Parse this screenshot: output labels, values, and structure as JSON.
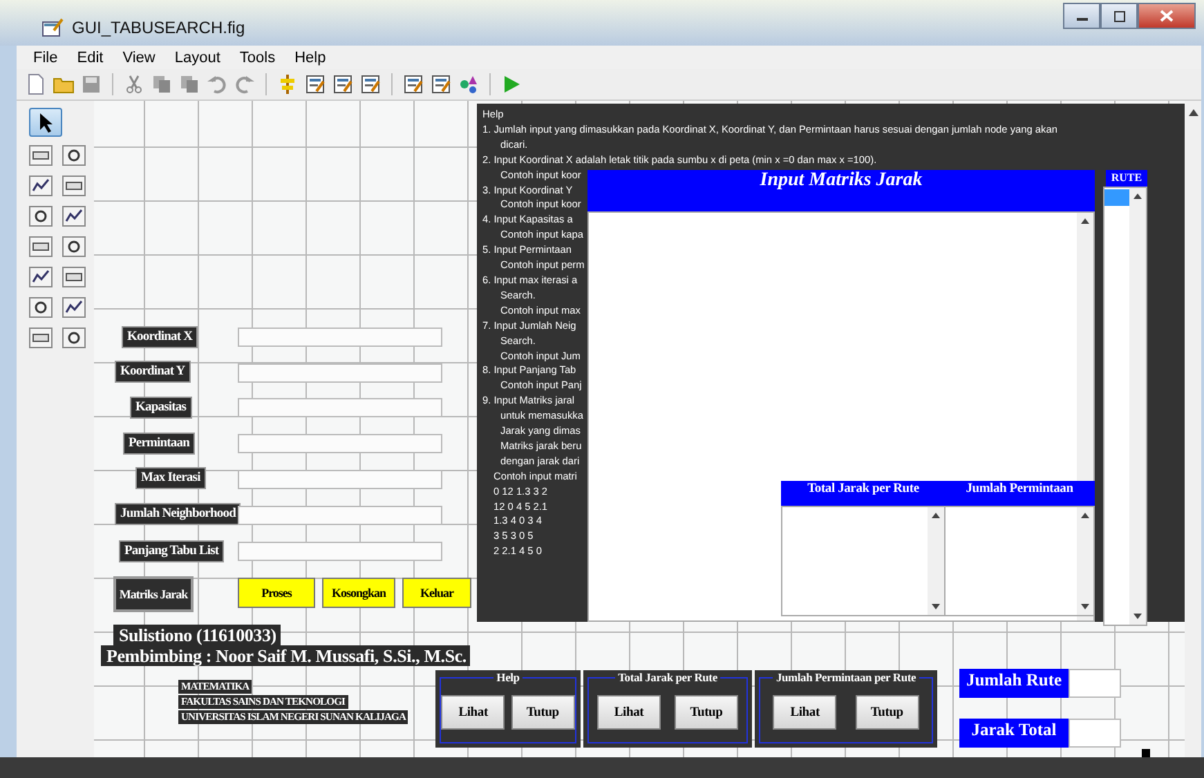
{
  "window": {
    "title": "GUI_TABUSEARCH.fig"
  },
  "menu": [
    "File",
    "Edit",
    "View",
    "Layout",
    "Tools",
    "Help"
  ],
  "fields": [
    {
      "label": "Koordinat X"
    },
    {
      "label": "Koordinat Y"
    },
    {
      "label": "Kapasitas"
    },
    {
      "label": "Permintaan"
    },
    {
      "label": "Max Iterasi"
    },
    {
      "label": "Jumlah Neighborhood"
    },
    {
      "label": "Panjang Tabu List"
    }
  ],
  "buttons": [
    {
      "label": "Matriks Jarak",
      "kind": "dark"
    },
    {
      "label": "Proses",
      "kind": "yellow"
    },
    {
      "label": "Kosongkan",
      "kind": "yellow"
    },
    {
      "label": "Keluar",
      "kind": "yellow"
    }
  ],
  "author": {
    "name": "Sulistiono (11610033)",
    "supervisor": "Pembimbing : Noor Saif M. Mussafi, S.Si., M.Sc."
  },
  "institution": [
    "MATEMATIKA",
    "FAKULTAS SAINS DAN TEKNOLOGI",
    "UNIVERSITAS ISLAM NEGERI SUNAN KALIJAGA"
  ],
  "help_panel": {
    "lines": [
      {
        "kind": "plain",
        "text": "Help"
      },
      {
        "kind": "item",
        "text": "1. Jumlah input yang dimasukkan pada Koordinat X, Koordinat Y, dan Permintaan harus sesuai dengan jumlah node yang akan"
      },
      {
        "kind": "cont",
        "text": "dicari."
      },
      {
        "kind": "item",
        "text": "2. Input Koordinat X adalah letak titik pada sumbu x di peta (min x =0 dan max x =100)."
      },
      {
        "kind": "cont",
        "text": "Contoh input koor"
      },
      {
        "kind": "item",
        "text": "3. Input Koordinat Y"
      },
      {
        "kind": "cont",
        "text": "Contoh input koor"
      },
      {
        "kind": "item",
        "text": "4. Input Kapasitas a"
      },
      {
        "kind": "cont",
        "text": "Contoh input kapa"
      },
      {
        "kind": "item",
        "text": "5. Input Permintaan"
      },
      {
        "kind": "cont",
        "text": "Contoh input perm"
      },
      {
        "kind": "item",
        "text": "6. Input max iterasi a"
      },
      {
        "kind": "cont",
        "text": "Search."
      },
      {
        "kind": "cont",
        "text": "Contoh input max"
      },
      {
        "kind": "item",
        "text": "7. Input Jumlah Neig"
      },
      {
        "kind": "cont",
        "text": "Search."
      },
      {
        "kind": "cont",
        "text": "Contoh input Jum"
      },
      {
        "kind": "item",
        "text": "8. Input Panjang Tab"
      },
      {
        "kind": "cont",
        "text": "Contoh input Panj"
      },
      {
        "kind": "item",
        "text": "9. Input Matriks jaral"
      },
      {
        "kind": "cont",
        "text": "untuk memasukka"
      },
      {
        "kind": "cont",
        "text": "Jarak yang dimas"
      },
      {
        "kind": "cont",
        "text": "Matriks jarak beru"
      },
      {
        "kind": "cont",
        "text": "dengan jarak dari"
      },
      {
        "kind": "sample",
        "text": "Contoh input matri"
      },
      {
        "kind": "sample",
        "text": "0 12 1.3 3 2"
      },
      {
        "kind": "sample",
        "text": "12 0 4 5 2.1"
      },
      {
        "kind": "sample",
        "text": "1.3 4 0 3 4"
      },
      {
        "kind": "sample",
        "text": "3 5 3 0 5"
      },
      {
        "kind": "sample",
        "text": "2 2.1 4 5 0"
      }
    ]
  },
  "matrix_panel": {
    "title": "Input Matriks Jarak"
  },
  "route_panel": {
    "title": "RUTE"
  },
  "sub_lists": [
    {
      "title": "Total Jarak per Rute"
    },
    {
      "title": "Jumlah Permintaan"
    }
  ],
  "button_groups": [
    {
      "title": "Help",
      "buttons": [
        "Lihat",
        "Tutup"
      ]
    },
    {
      "title": "Total Jarak per Rute",
      "buttons": [
        "Lihat",
        "Tutup"
      ]
    },
    {
      "title": "Jumlah Permintaan per Rute",
      "buttons": [
        "Lihat",
        "Tutup"
      ]
    }
  ],
  "results": [
    {
      "label": "Jumlah Rute"
    },
    {
      "label": "Jarak Total"
    }
  ]
}
